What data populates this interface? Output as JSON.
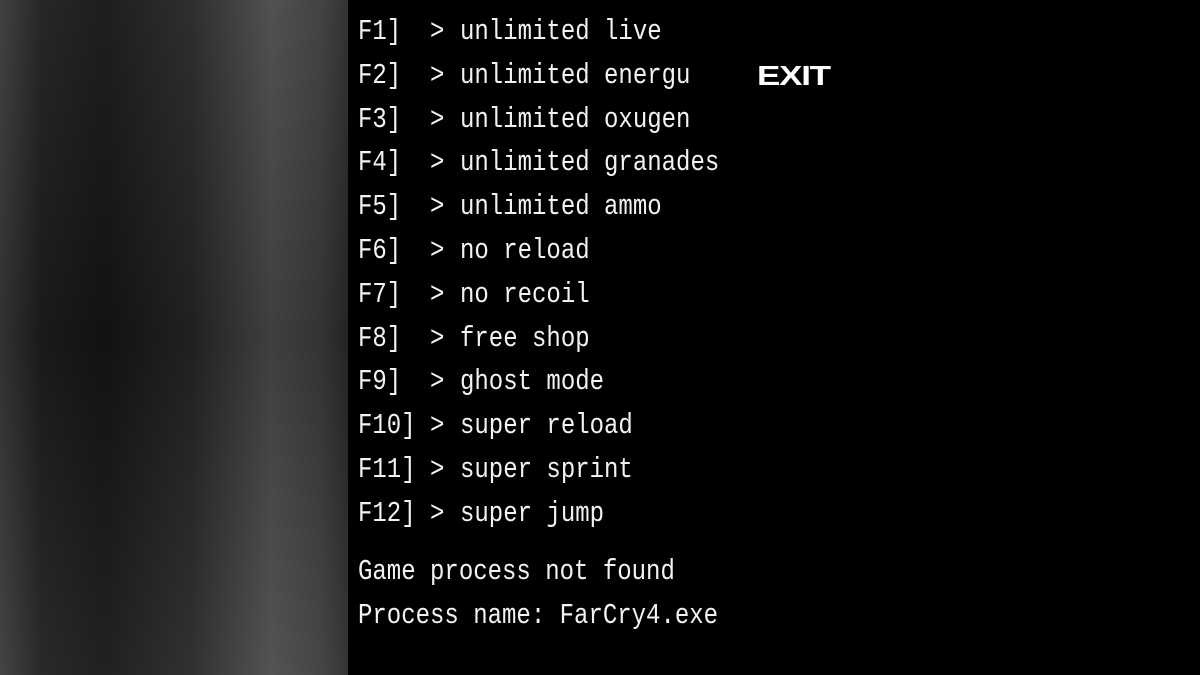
{
  "exit_label": "EXIT",
  "hotkeys": [
    {
      "key": "F1]",
      "arrow": ">",
      "label": "unlimited live"
    },
    {
      "key": "F2]",
      "arrow": ">",
      "label": "unlimited energu"
    },
    {
      "key": "F3]",
      "arrow": ">",
      "label": "unlimited oxugen"
    },
    {
      "key": "F4]",
      "arrow": ">",
      "label": "unlimited granades"
    },
    {
      "key": "F5]",
      "arrow": ">",
      "label": "unlimited ammo"
    },
    {
      "key": "F6]",
      "arrow": ">",
      "label": "no reload"
    },
    {
      "key": "F7]",
      "arrow": ">",
      "label": "no recoil"
    },
    {
      "key": "F8]",
      "arrow": ">",
      "label": "free shop"
    },
    {
      "key": "F9]",
      "arrow": ">",
      "label": "ghost mode"
    },
    {
      "key": "F10]",
      "arrow": ">",
      "label": "super reload"
    },
    {
      "key": "F11]",
      "arrow": ">",
      "label": "super sprint"
    },
    {
      "key": "F12]",
      "arrow": ">",
      "label": "super jump"
    }
  ],
  "status": {
    "message": "Game process not found",
    "process_name": "Process name: FarCry4.exe"
  },
  "colors": {
    "text": "#f2f2f2",
    "background": "#000000"
  }
}
